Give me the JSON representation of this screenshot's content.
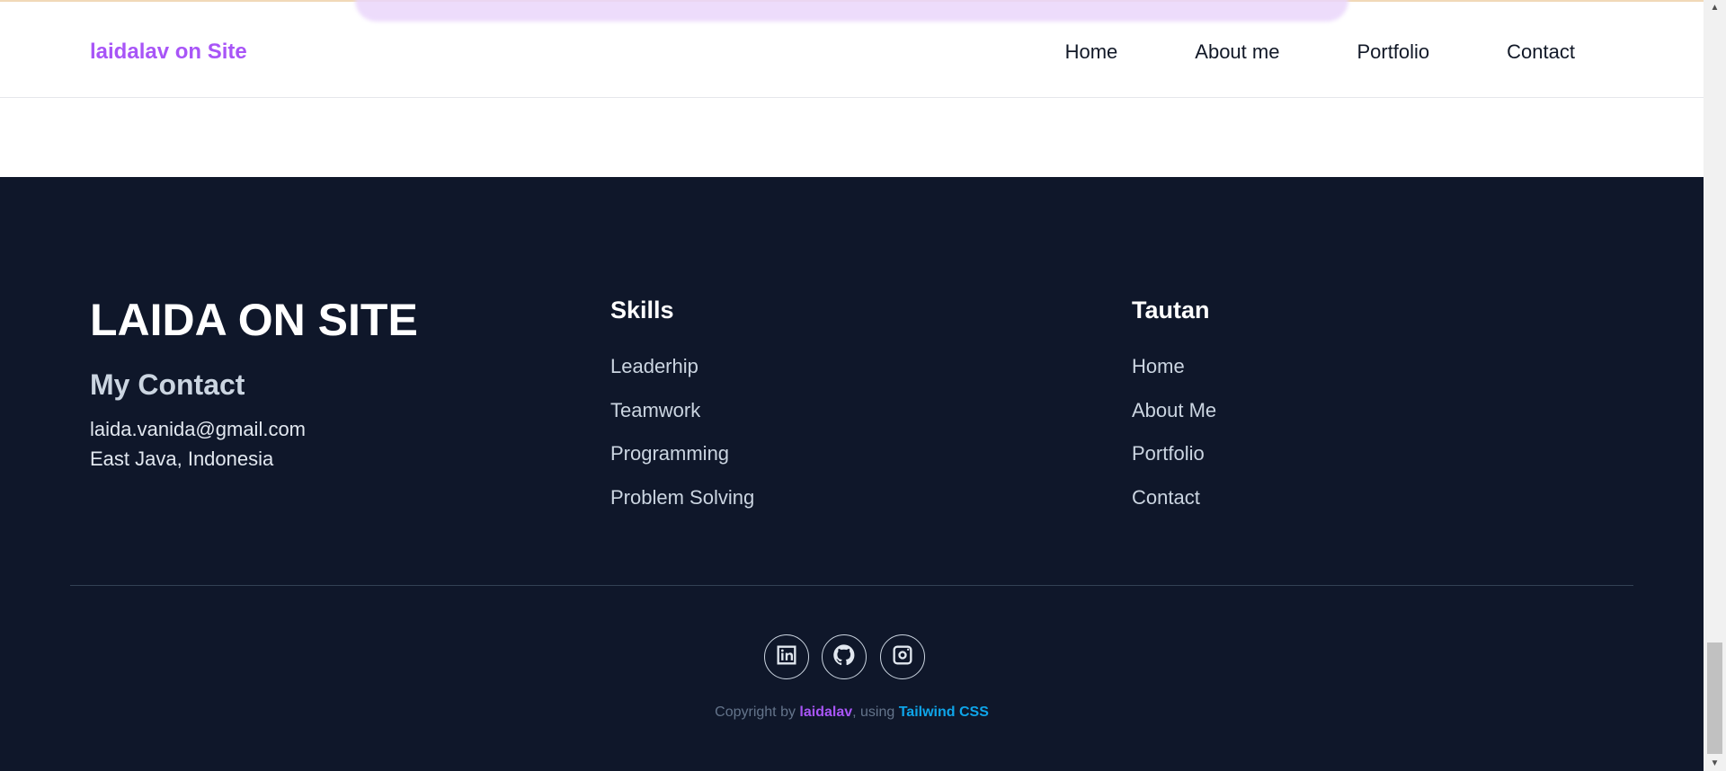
{
  "header": {
    "brand": "laidalav on Site",
    "nav": [
      "Home",
      "About me",
      "Portfolio",
      "Contact"
    ]
  },
  "footer": {
    "site_title": "LAIDA ON SITE",
    "contact_heading": "My Contact",
    "email": "laida.vanida@gmail.com",
    "location": "East Java, Indonesia",
    "skills": {
      "heading": "Skills",
      "items": [
        "Leaderhip",
        "Teamwork",
        "Programming",
        "Problem Solving"
      ]
    },
    "links": {
      "heading": "Tautan",
      "items": [
        "Home",
        "About Me",
        "Portfolio",
        "Contact"
      ]
    },
    "social_icons": [
      "linkedin-icon",
      "github-icon",
      "instagram-icon"
    ],
    "copyright": {
      "prefix": "Copyright by ",
      "author": "laidalav",
      "middle": ", using ",
      "tech": "Tailwind CSS"
    }
  },
  "colors": {
    "brand": "#a855f7",
    "footer_bg": "#0f172a",
    "tailwind": "#0ea5e9"
  }
}
